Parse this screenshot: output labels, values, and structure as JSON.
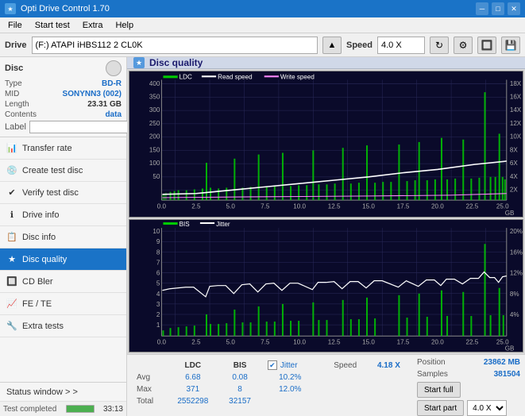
{
  "app": {
    "title": "Opti Drive Control 1.70",
    "icon": "★"
  },
  "titlebar": {
    "minimize_label": "─",
    "maximize_label": "□",
    "close_label": "✕"
  },
  "menubar": {
    "items": [
      "File",
      "Start test",
      "Extra",
      "Help"
    ]
  },
  "drivebar": {
    "label": "Drive",
    "drive_value": "(F:)  ATAPI iHBS112  2 CL0K",
    "speed_label": "Speed",
    "speed_value": "4.0 X"
  },
  "disc": {
    "section_title": "Disc",
    "type_label": "Type",
    "type_value": "BD-R",
    "mid_label": "MID",
    "mid_value": "SONYNN3 (002)",
    "length_label": "Length",
    "length_value": "23.31 GB",
    "contents_label": "Contents",
    "contents_value": "data",
    "label_label": "Label"
  },
  "nav": {
    "items": [
      {
        "id": "transfer-rate",
        "label": "Transfer rate",
        "icon": "📊"
      },
      {
        "id": "create-test-disc",
        "label": "Create test disc",
        "icon": "💿"
      },
      {
        "id": "verify-test-disc",
        "label": "Verify test disc",
        "icon": "✔"
      },
      {
        "id": "drive-info",
        "label": "Drive info",
        "icon": "ℹ"
      },
      {
        "id": "disc-info",
        "label": "Disc info",
        "icon": "📋"
      },
      {
        "id": "disc-quality",
        "label": "Disc quality",
        "icon": "★",
        "active": true
      },
      {
        "id": "cd-bler",
        "label": "CD Bler",
        "icon": "🔲"
      },
      {
        "id": "fe-te",
        "label": "FE / TE",
        "icon": "📈"
      },
      {
        "id": "extra-tests",
        "label": "Extra tests",
        "icon": "🔧"
      }
    ]
  },
  "status_window": {
    "label": "Status window > >"
  },
  "progress": {
    "value": 100,
    "text": "Test completed",
    "time": "33:13"
  },
  "disc_quality": {
    "title": "Disc quality",
    "icon": "★",
    "chart1": {
      "legend": [
        {
          "label": "LDC",
          "color": "#00cc00"
        },
        {
          "label": "Read speed",
          "color": "#ffffff"
        },
        {
          "label": "Write speed",
          "color": "#ff88ff"
        }
      ],
      "y_max": 400,
      "y_right_max": 18,
      "x_max": 25,
      "x_label": "GB",
      "y_ticks": [
        400,
        350,
        300,
        250,
        200,
        150,
        100,
        50
      ],
      "y_right_ticks": [
        18,
        16,
        14,
        12,
        10,
        8,
        6,
        4,
        2
      ]
    },
    "chart2": {
      "legend": [
        {
          "label": "BIS",
          "color": "#00cc00"
        },
        {
          "label": "Jitter",
          "color": "#ffffff"
        }
      ],
      "y_max": 10,
      "y_right_max": 20,
      "x_max": 25,
      "x_label": "GB",
      "y_ticks": [
        10,
        9,
        8,
        7,
        6,
        5,
        4,
        3,
        2,
        1
      ],
      "y_right_ticks": [
        20,
        16,
        12,
        8,
        4
      ]
    }
  },
  "stats": {
    "columns": [
      "LDC",
      "BIS"
    ],
    "jitter_label": "Jitter",
    "jitter_checked": true,
    "speed_label": "Speed",
    "speed_value1": "4.18 X",
    "speed_value2": "4.0 X",
    "rows": [
      {
        "label": "Avg",
        "ldc": "6.68",
        "bis": "0.08",
        "jitter": "10.2%"
      },
      {
        "label": "Max",
        "ldc": "371",
        "bis": "8",
        "jitter": "12.0%"
      },
      {
        "label": "Total",
        "ldc": "2552298",
        "bis": "32157",
        "jitter": ""
      }
    ],
    "position_label": "Position",
    "position_value": "23862 MB",
    "samples_label": "Samples",
    "samples_value": "381504",
    "btn_start_full": "Start full",
    "btn_start_part": "Start part"
  }
}
